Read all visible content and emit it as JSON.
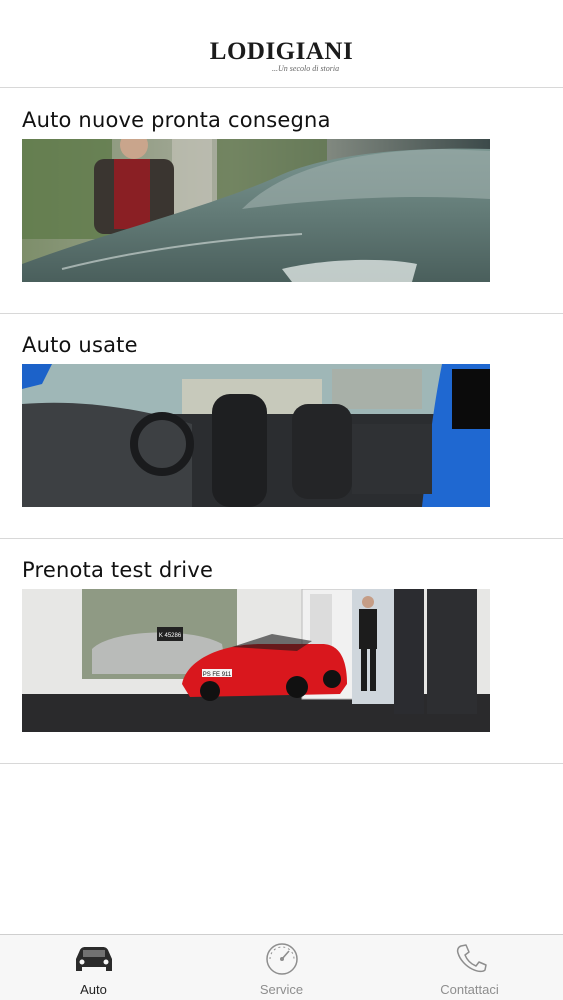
{
  "header": {
    "logo_text": "LODIGIANI",
    "logo_tagline": "...Un secolo di storia"
  },
  "sections": [
    {
      "title": "Auto nuove pronta consegna",
      "image": "new-car-showroom-image"
    },
    {
      "title": "Auto usate",
      "image": "used-car-interior-image"
    },
    {
      "title": "Prenota test drive",
      "image": "red-sports-car-showroom-image"
    }
  ],
  "image_text": {
    "plate_silver": "K 45286",
    "plate_red": "PS FE 911"
  },
  "tabbar": {
    "tabs": [
      {
        "label": "Auto",
        "icon": "car-icon",
        "active": true
      },
      {
        "label": "Service",
        "icon": "speedometer-icon",
        "active": false
      },
      {
        "label": "Contattaci",
        "icon": "phone-icon",
        "active": false
      }
    ]
  },
  "colors": {
    "active_tab": "#222222",
    "inactive_tab": "#8e8e8e",
    "divider": "#d8d8d8",
    "tabbar_bg": "#f7f7f7"
  }
}
